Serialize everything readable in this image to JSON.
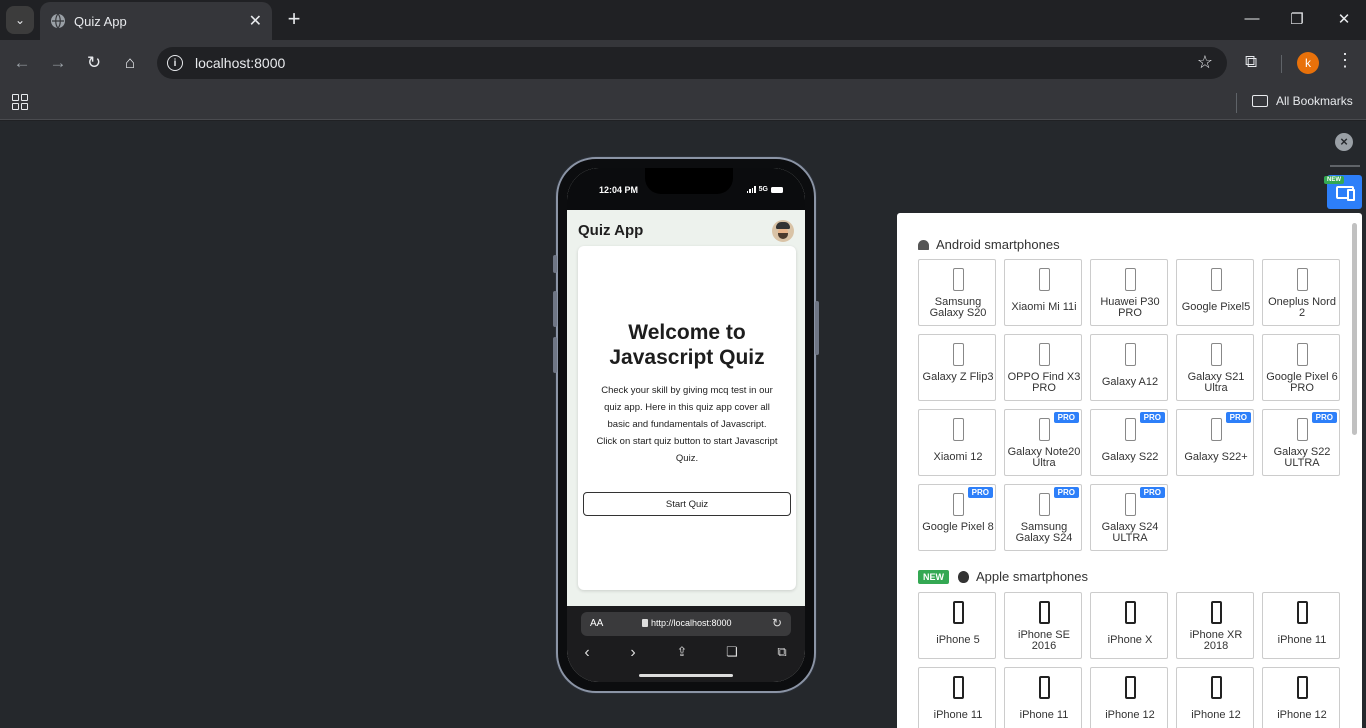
{
  "browser": {
    "tab_title": "Quiz App",
    "tab_close": "✕",
    "new_tab": "+",
    "url": "localhost:8000",
    "profile_initial": "k",
    "bookmarks_label": "All Bookmarks",
    "win_minimize": "—",
    "win_restore": "❐",
    "win_close": "✕"
  },
  "phone": {
    "time": "12:04 PM",
    "network": "5G",
    "app_title": "Quiz App",
    "welcome_heading": "Welcome to Javascript Quiz",
    "description": "Check your skill by giving mcq test in our quiz app. Here in this quiz app cover all basic and fundamentals of Javascript. Click on start quiz button to start Javascript Quiz.",
    "start_button": "Start Quiz",
    "safari_aa": "AA",
    "safari_url": "http://localhost:8000"
  },
  "panel": {
    "new_tag_small": "NEW",
    "android_heading": "Android smartphones",
    "apple_heading": "Apple smartphones",
    "apple_new_badge": "NEW",
    "pro_label": "PRO",
    "android_devices": [
      {
        "name": "Samsung Galaxy S20",
        "pro": false
      },
      {
        "name": "Xiaomi Mi 11i",
        "pro": false
      },
      {
        "name": "Huawei P30 PRO",
        "pro": false
      },
      {
        "name": "Google Pixel5",
        "pro": false
      },
      {
        "name": "Oneplus Nord 2",
        "pro": false
      },
      {
        "name": "Galaxy Z Flip3",
        "pro": false
      },
      {
        "name": "OPPO Find X3 PRO",
        "pro": false
      },
      {
        "name": "Galaxy A12",
        "pro": false
      },
      {
        "name": "Galaxy S21 Ultra",
        "pro": false
      },
      {
        "name": "Google Pixel 6 PRO",
        "pro": false
      },
      {
        "name": "Xiaomi 12",
        "pro": false
      },
      {
        "name": "Galaxy Note20 Ultra",
        "pro": true
      },
      {
        "name": "Galaxy S22",
        "pro": true
      },
      {
        "name": "Galaxy S22+",
        "pro": true
      },
      {
        "name": "Galaxy S22 ULTRA",
        "pro": true
      },
      {
        "name": "Google Pixel 8",
        "pro": true
      },
      {
        "name": "Samsung Galaxy S24",
        "pro": true
      },
      {
        "name": "Galaxy S24 ULTRA",
        "pro": true
      }
    ],
    "apple_devices": [
      {
        "name": "iPhone 5"
      },
      {
        "name": "iPhone SE 2016"
      },
      {
        "name": "iPhone X"
      },
      {
        "name": "iPhone XR 2018"
      },
      {
        "name": "iPhone 11"
      },
      {
        "name": "iPhone 11"
      },
      {
        "name": "iPhone 11"
      },
      {
        "name": "iPhone 12"
      },
      {
        "name": "iPhone 12"
      },
      {
        "name": "iPhone 12"
      }
    ]
  }
}
